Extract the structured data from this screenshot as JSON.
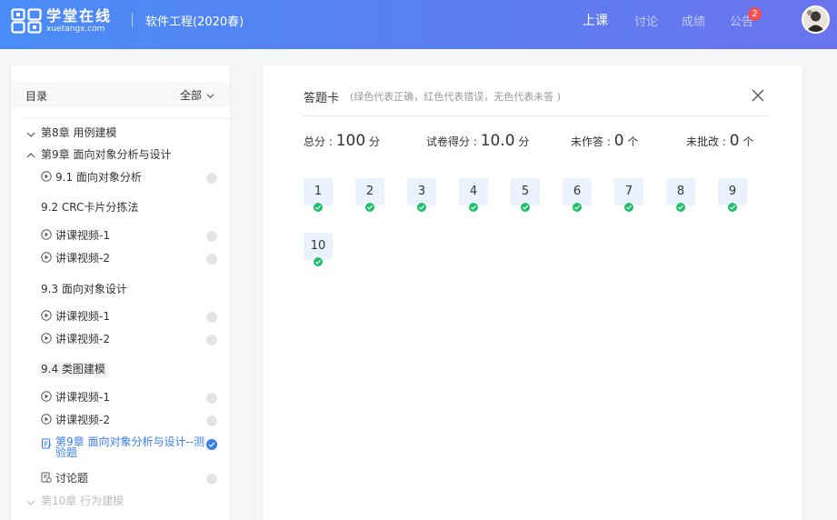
{
  "header": {
    "brand_name": "学堂在线",
    "brand_url": "xuetangx.com",
    "course_title": "软件工程(2020春)",
    "nav": {
      "lesson": "上课",
      "discuss": "讨论",
      "grades": "成绩",
      "notice": "公告",
      "notice_badge": "2"
    }
  },
  "sidebar": {
    "title": "目录",
    "filter": "全部",
    "ch8": "第8章 用例建模",
    "ch9": "第9章 面向对象分析与设计",
    "s91": "9.1 面向对象分析",
    "s92": "9.2 CRC卡片分拣法",
    "s92_v1": "讲课视频-1",
    "s92_v2": "讲课视频-2",
    "s93": "9.3 面向对象设计",
    "s93_v1": "讲课视频-1",
    "s93_v2": "讲课视频-2",
    "s94": "9.4 类图建模",
    "s94_v1": "讲课视频-1",
    "s94_v2": "讲课视频-2",
    "quiz_line1": "第9章 面向对象分析与设计--测",
    "quiz_line2": "验题",
    "discussion": "讨论题",
    "ch10": "第10章 行为建模"
  },
  "answer_card": {
    "title": "答题卡",
    "hint": "(绿色代表正确，红色代表错误，无色代表未答 )",
    "total_label": "总分 : ",
    "total_value": "100",
    "total_unit": " 分",
    "score_label": "试卷得分 : ",
    "score_value": "10.0",
    "score_unit": " 分",
    "unanswered_label": "未作答 : ",
    "unanswered_value": "0",
    "unanswered_unit": " 个",
    "ungraded_label": "未批改 : ",
    "ungraded_value": "0",
    "ungraded_unit": " 个",
    "questions": [
      {
        "n": "1",
        "status": "correct"
      },
      {
        "n": "2",
        "status": "correct"
      },
      {
        "n": "3",
        "status": "correct"
      },
      {
        "n": "4",
        "status": "correct"
      },
      {
        "n": "5",
        "status": "correct"
      },
      {
        "n": "6",
        "status": "correct"
      },
      {
        "n": "7",
        "status": "correct"
      },
      {
        "n": "8",
        "status": "correct"
      },
      {
        "n": "9",
        "status": "correct"
      },
      {
        "n": "10",
        "status": "correct"
      }
    ]
  },
  "colors": {
    "accent": "#3a7ef2",
    "correct": "#1fc06a",
    "badge": "#f25252"
  }
}
